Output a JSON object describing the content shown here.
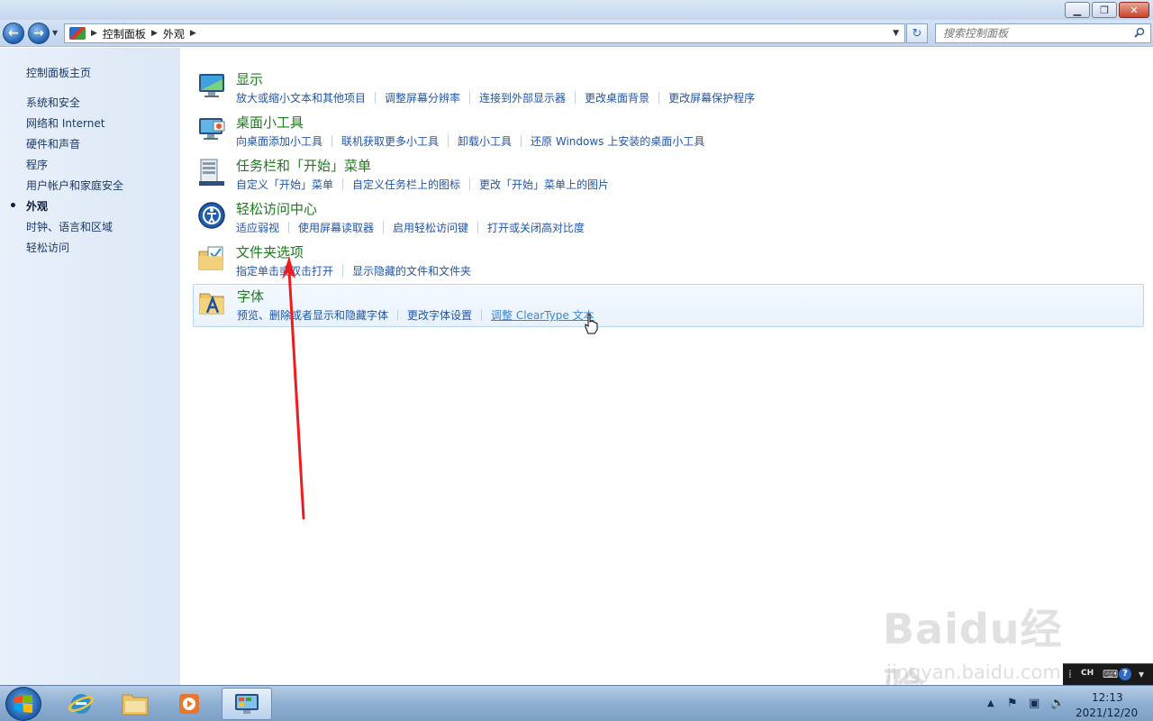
{
  "window": {
    "minimize_glyph": "▁",
    "maximize_glyph": "❐",
    "close_glyph": "✕"
  },
  "navigation": {
    "breadcrumb": [
      "控制面板",
      "外观"
    ],
    "search_placeholder": "搜索控制面板"
  },
  "sidebar": {
    "home": "控制面板主页",
    "items": [
      {
        "label": "系统和安全",
        "current": false
      },
      {
        "label": "网络和 Internet",
        "current": false
      },
      {
        "label": "硬件和声音",
        "current": false
      },
      {
        "label": "程序",
        "current": false
      },
      {
        "label": "用户帐户和家庭安全",
        "current": false
      },
      {
        "label": "外观",
        "current": true
      },
      {
        "label": "时钟、语言和区域",
        "current": false
      },
      {
        "label": "轻松访问",
        "current": false
      }
    ]
  },
  "main": {
    "categories": [
      {
        "title": "显示",
        "icon": "display-icon",
        "links": [
          "放大或缩小文本和其他项目",
          "调整屏幕分辨率",
          "连接到外部显示器",
          "更改桌面背景",
          "更改屏幕保护程序"
        ]
      },
      {
        "title": "桌面小工具",
        "icon": "gadgets-icon",
        "links": [
          "向桌面添加小工具",
          "联机获取更多小工具",
          "卸载小工具",
          "还原 Windows 上安装的桌面小工具"
        ]
      },
      {
        "title": "任务栏和「开始」菜单",
        "icon": "taskbar-icon",
        "links": [
          "自定义「开始」菜单",
          "自定义任务栏上的图标",
          "更改「开始」菜单上的图片"
        ]
      },
      {
        "title": "轻松访问中心",
        "icon": "ease-of-access-icon",
        "links": [
          "适应弱视",
          "使用屏幕读取器",
          "启用轻松访问键",
          "打开或关闭高对比度"
        ]
      },
      {
        "title": "文件夹选项",
        "icon": "folder-options-icon",
        "links": [
          "指定单击或双击打开",
          "显示隐藏的文件和文件夹"
        ]
      },
      {
        "title": "字体",
        "icon": "fonts-icon",
        "hovered": true,
        "hovered_link_index": 2,
        "links": [
          "预览、删除或者显示和隐藏字体",
          "更改字体设置",
          "调整 ClearType 文本"
        ]
      }
    ]
  },
  "watermark": {
    "brand": "Baidu经验",
    "url": "jingyan.baidu.com"
  },
  "taskbar": {
    "apps": [
      {
        "name": "internet-explorer-icon",
        "active": false
      },
      {
        "name": "file-explorer-icon",
        "active": false
      },
      {
        "name": "media-player-icon",
        "active": false
      },
      {
        "name": "control-panel-icon",
        "active": true
      }
    ],
    "language_code": "CH",
    "clock_time": "12:13",
    "clock_date": "2021/12/20"
  },
  "colors": {
    "category_title": "#1f7a1f",
    "link": "#1f55a8",
    "annotation_arrow": "#ee1c1c"
  }
}
